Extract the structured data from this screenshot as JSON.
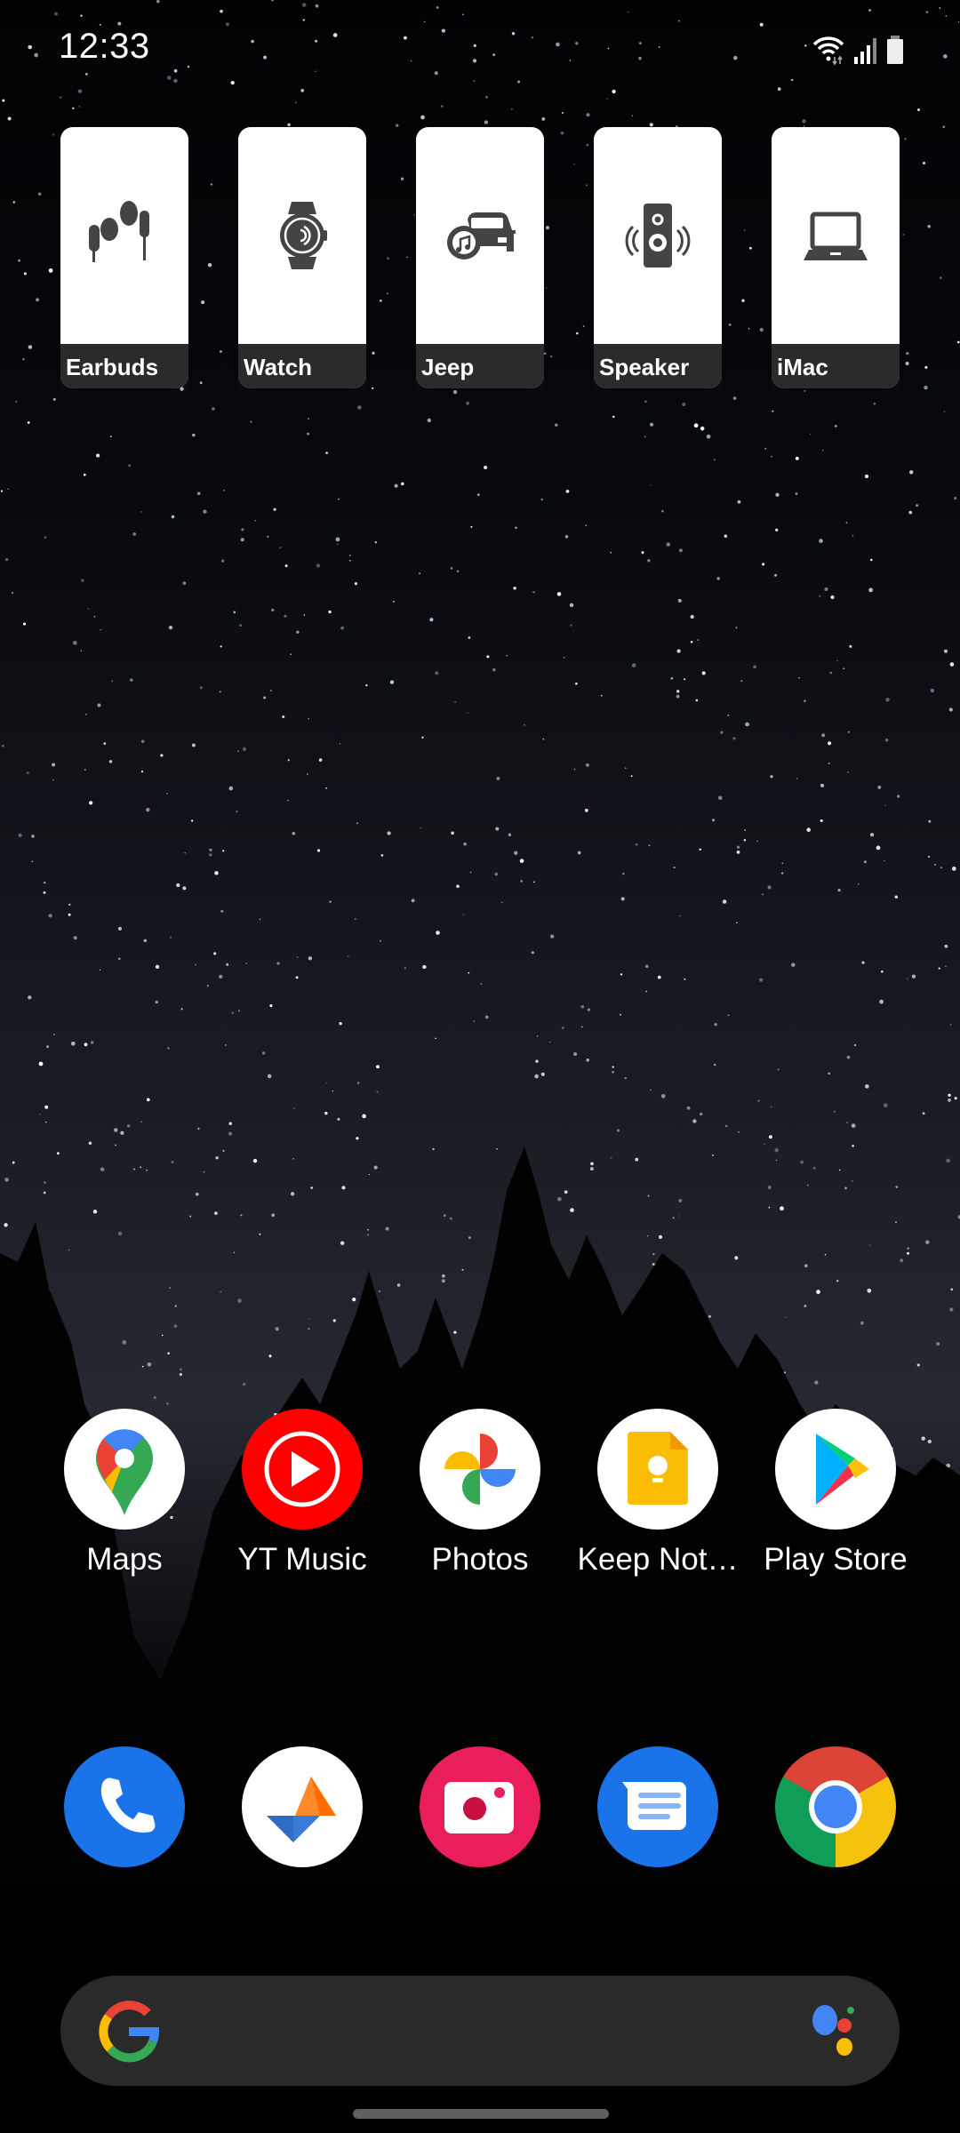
{
  "status_bar": {
    "time": "12:33",
    "icons": [
      "wifi-icon",
      "cellular-signal-icon",
      "battery-icon"
    ]
  },
  "device_tiles": [
    {
      "label": "Earbuds",
      "icon": "earbuds-icon"
    },
    {
      "label": "Watch",
      "icon": "smartwatch-icon"
    },
    {
      "label": "Jeep",
      "icon": "car-music-icon"
    },
    {
      "label": "Speaker",
      "icon": "speaker-icon"
    },
    {
      "label": "iMac",
      "icon": "laptop-icon"
    }
  ],
  "apps": [
    {
      "label": "Maps",
      "icon": "google-maps-icon"
    },
    {
      "label": "YT Music",
      "icon": "youtube-music-icon"
    },
    {
      "label": "Photos",
      "icon": "google-photos-icon"
    },
    {
      "label": "Keep Not…",
      "icon": "google-keep-icon"
    },
    {
      "label": "Play Store",
      "icon": "play-store-icon"
    }
  ],
  "dock": [
    {
      "icon": "phone-icon"
    },
    {
      "icon": "kite-app-icon"
    },
    {
      "icon": "camera-icon"
    },
    {
      "icon": "messages-icon"
    },
    {
      "icon": "chrome-icon"
    }
  ],
  "search_bar": {
    "left_icon": "google-g-icon",
    "right_icon": "google-assistant-icon",
    "placeholder": ""
  },
  "colors": {
    "tile_bg": "#ffffff",
    "tile_label_bg": "#2b2b2b",
    "tile_icon": "#444444",
    "search_bg": "#2a2a2a",
    "yt_red": "#ff0000",
    "phone_blue": "#1a73e8",
    "camera_pink": "#ea1e5a"
  }
}
